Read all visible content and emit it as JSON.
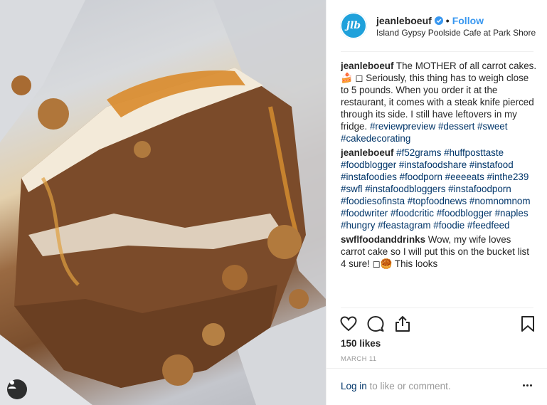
{
  "post": {
    "author": "jeanleboeuf",
    "avatar_initials": "jlb",
    "follow_label": "Follow",
    "location": "Island Gypsy Poolside Cafe at Park Shore",
    "likes": "150 likes",
    "date": "MARCH 11"
  },
  "caption": {
    "user": "jeanleboeuf",
    "text": "The MOTHER of all carrot cakes. 🍰 ◻ Seriously, this thing has to weigh close to 5 pounds. When you order it at the restaurant, it comes with a steak knife pierced through its side. I still have leftovers in my fridge.",
    "hashtags": "#reviewpreview #dessert #sweet #cakedecorating"
  },
  "comments": [
    {
      "user": "jeanleboeuf",
      "text": "",
      "hashtags": "#f52grams #huffposttaste #foodblogger #instafoodshare #instafood #instafoodies #foodporn #eeeeats #inthe239 #swfl #instafoodbloggers #instafoodporn #foodiesofinsta #topfoodnews #nomnomnom #foodwriter #foodcritic #foodblogger #naples #hungry #feastagram #foodie #feedfeed"
    },
    {
      "user": "swflfoodanddrinks",
      "text": "Wow, my wife loves carrot cake so I will put this on the bucket list 4 sure! ◻🥮   This looks",
      "hashtags": ""
    }
  ],
  "footer": {
    "login_link": "Log in",
    "login_suffix": " to like or comment."
  },
  "icons": {
    "like": "heart-icon",
    "comment": "speech-bubble-icon",
    "share": "share-icon",
    "save": "bookmark-icon",
    "verified": "verified-badge-icon",
    "more": "more-options-icon",
    "tagged_user": "user-icon"
  },
  "colors": {
    "accent": "#3897f0",
    "hashtag": "#003569",
    "avatar": "#1fa1db"
  }
}
